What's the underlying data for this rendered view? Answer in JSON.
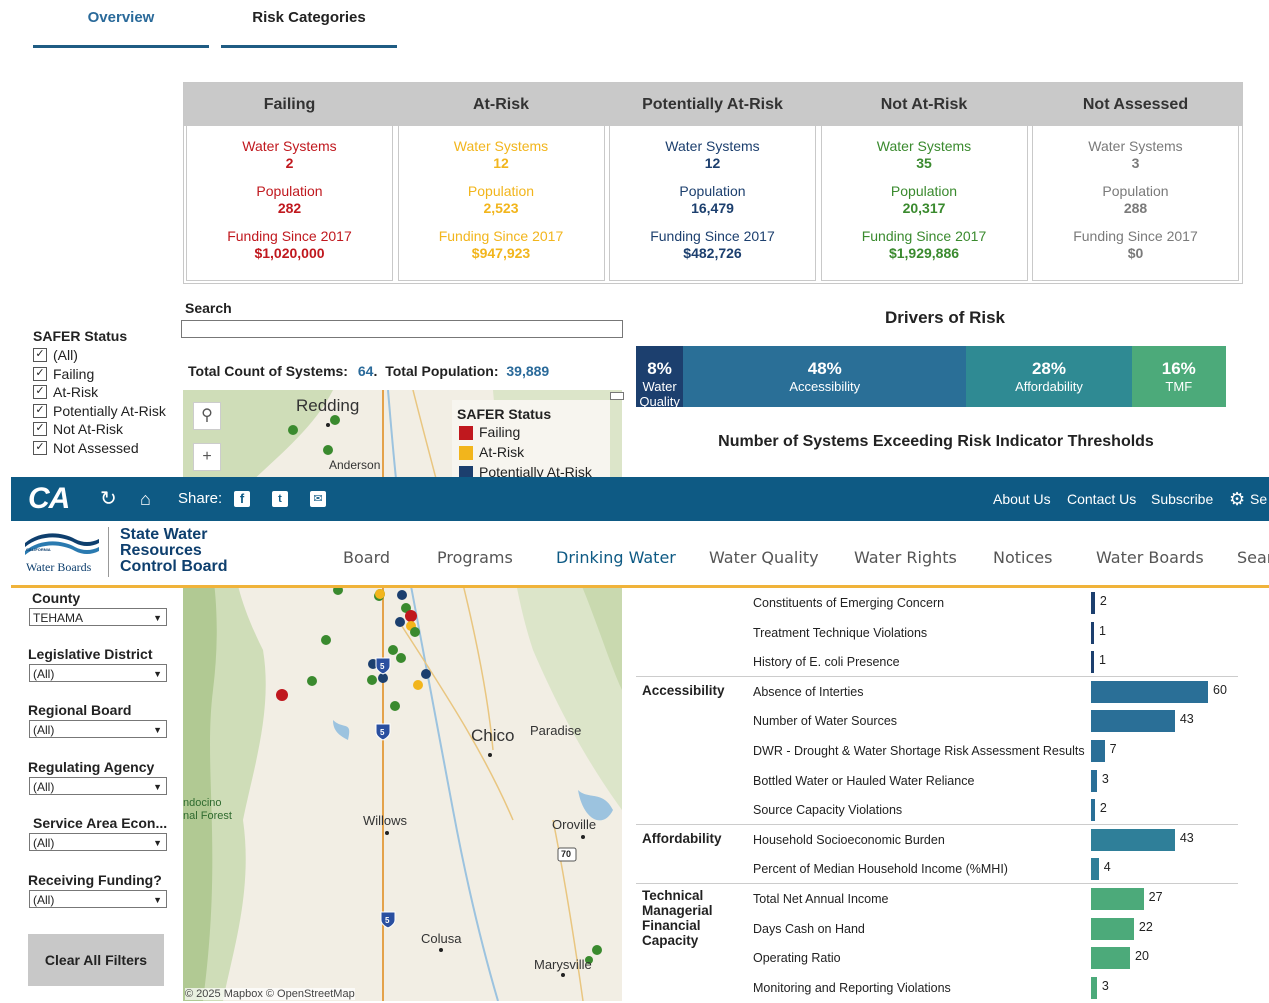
{
  "tabs": [
    {
      "label": "Overview"
    },
    {
      "label": "Risk Categories"
    }
  ],
  "summary": [
    {
      "header": "Failing",
      "color": "#c0181e",
      "systems_label": "Water Systems",
      "systems": "2",
      "population_label": "Population",
      "population": "282",
      "funding_label": "Funding Since 2017",
      "funding": "$1,020,000"
    },
    {
      "header": "At-Risk",
      "color": "#f2b51c",
      "systems_label": "Water Systems",
      "systems": "12",
      "population_label": "Population",
      "population": "2,523",
      "funding_label": "Funding Since 2017",
      "funding": "$947,923"
    },
    {
      "header": "Potentially At-Risk",
      "color": "#1c3f6e",
      "systems_label": "Water Systems",
      "systems": "12",
      "population_label": "Population",
      "population": "16,479",
      "funding_label": "Funding Since 2017",
      "funding": "$482,726"
    },
    {
      "header": "Not At-Risk",
      "color": "#3a8a2e",
      "systems_label": "Water Systems",
      "systems": "35",
      "population_label": "Population",
      "population": "20,317",
      "funding_label": "Funding Since 2017",
      "funding": "$1,929,886"
    },
    {
      "header": "Not Assessed",
      "color": "#7a7a7a",
      "systems_label": "Water Systems",
      "systems": "3",
      "population_label": "Population",
      "population": "288",
      "funding_label": "Funding Since 2017",
      "funding": "$0"
    }
  ],
  "search": {
    "label": "Search",
    "value": ""
  },
  "totals": {
    "count_label": "Total Count of Systems:",
    "count": "64",
    "pop_label": "Total Population:",
    "pop": "39,889"
  },
  "safer_filter": {
    "title": "SAFER Status",
    "options": [
      "(All)",
      "Failing",
      "At-Risk",
      "Potentially At-Risk",
      "Not At-Risk",
      "Not Assessed"
    ]
  },
  "filters": [
    {
      "label": "County",
      "value": "TEHAMA"
    },
    {
      "label": "Legislative District",
      "value": "(All)"
    },
    {
      "label": "Regional Board",
      "value": "(All)"
    },
    {
      "label": "Regulating Agency",
      "value": "(All)"
    },
    {
      "label": "Service Area Econ...",
      "value": "(All)"
    },
    {
      "label": "Receiving Funding?",
      "value": "(All)"
    }
  ],
  "clear_filters": "Clear All Filters",
  "map": {
    "legend_title": "SAFER Status",
    "legend_items": [
      {
        "label": "Failing",
        "color": "#c0181e"
      },
      {
        "label": "At-Risk",
        "color": "#f2b51c"
      },
      {
        "label": "Potentially At-Risk",
        "color": "#1c3f6e"
      }
    ],
    "places": [
      "Redding",
      "Anderson",
      "Chico",
      "Paradise",
      "Willows",
      "Oroville",
      "Colusa",
      "Marysville",
      "ndocino",
      "nal Forest"
    ],
    "highways": [
      "5",
      "5",
      "5",
      "70"
    ],
    "attribution": "© 2025 Mapbox  © OpenStreetMap"
  },
  "drivers": {
    "title": "Drivers of Risk",
    "segments": [
      {
        "pct": "8%",
        "name": "Water Quality",
        "color": "#1c3f6e"
      },
      {
        "pct": "48%",
        "name": "Accessibility",
        "color": "#2a6f97"
      },
      {
        "pct": "28%",
        "name": "Affordability",
        "color": "#2f8a93"
      },
      {
        "pct": "16%",
        "name": "TMF",
        "color": "#4caa7a"
      }
    ]
  },
  "indicators_title": "Number of Systems Exceeding Risk Indicator Thresholds",
  "header": {
    "share_label": "Share:",
    "links": [
      "About Us",
      "Contact Us",
      "Subscribe",
      "Se"
    ]
  },
  "brand": {
    "logo_line1": "State Water",
    "logo_line2": "Resources",
    "logo_line3": "Control Board",
    "logo_small_top": "CALIFORNIA",
    "logo_small": "Water Boards",
    "nav": [
      "Board",
      "Programs",
      "Drinking Water",
      "Water Quality",
      "Water Rights",
      "Notices",
      "Water Boards",
      "Sear"
    ]
  },
  "indicators": [
    {
      "category": "",
      "name": "Constituents of Emerging Concern",
      "value": 2,
      "color": "#1c3f6e"
    },
    {
      "category": "",
      "name": "Treatment Technique Violations",
      "value": 1,
      "color": "#1c3f6e"
    },
    {
      "category": "",
      "name": "History of E. coli Presence",
      "value": 1,
      "color": "#1c3f6e"
    },
    {
      "category": "Accessibility",
      "name": "Absence of Interties",
      "value": 60,
      "color": "#2a6f97"
    },
    {
      "category": "",
      "name": "Number of Water Sources",
      "value": 43,
      "color": "#2a6f97"
    },
    {
      "category": "",
      "name": "DWR - Drought & Water Shortage Risk Assessment Results",
      "value": 7,
      "color": "#2a6f97"
    },
    {
      "category": "",
      "name": "Bottled Water or Hauled Water Reliance",
      "value": 3,
      "color": "#2a6f97"
    },
    {
      "category": "",
      "name": "Source Capacity Violations",
      "value": 2,
      "color": "#2a6f97"
    },
    {
      "category": "Affordability",
      "name": "Household Socioeconomic Burden",
      "value": 43,
      "color": "#2f7f99"
    },
    {
      "category": "",
      "name": "Percent of Median Household Income (%MHI)",
      "value": 4,
      "color": "#2f7f99"
    },
    {
      "category": "Technical Managerial Financial Capacity",
      "name": "Total Net Annual Income",
      "value": 27,
      "color": "#4caa7a"
    },
    {
      "category": "",
      "name": "Days Cash on Hand",
      "value": 22,
      "color": "#4caa7a"
    },
    {
      "category": "",
      "name": "Operating Ratio",
      "value": 20,
      "color": "#4caa7a"
    },
    {
      "category": "",
      "name": "Monitoring and Reporting Violations",
      "value": 3,
      "color": "#4caa7a"
    }
  ]
}
